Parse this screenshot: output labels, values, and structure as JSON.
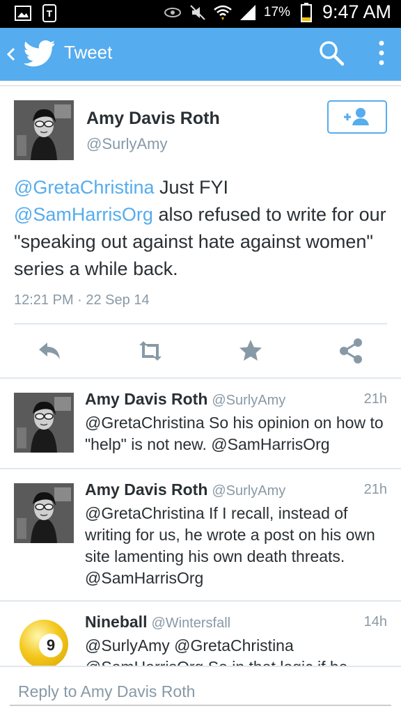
{
  "status_bar": {
    "battery_percent": "17%",
    "time": "9:47 AM",
    "icons": [
      "gallery-icon",
      "tmobile-icon",
      "eye-icon",
      "mute-icon",
      "wifi-icon",
      "signal-icon",
      "battery-icon"
    ]
  },
  "app_bar": {
    "title": "Tweet",
    "color": "#55acee",
    "icons": [
      "back-icon",
      "twitter-bird-icon",
      "search-icon",
      "overflow-menu-icon"
    ]
  },
  "main_tweet": {
    "author_name": "Amy Davis Roth",
    "author_handle": "@SurlyAmy",
    "follow_icon": "add-user-icon",
    "segments": [
      {
        "text": "@GretaChristina",
        "mention": true
      },
      {
        "text": " Just FYI ",
        "mention": false
      },
      {
        "text": "@SamHarrisOrg",
        "mention": true
      },
      {
        "text": " also refused to write for our \"speaking out against hate against women\" series a while back.",
        "mention": false
      }
    ],
    "timestamp": "12:21 PM · 22 Sep 14",
    "actions": [
      "reply-icon",
      "retweet-icon",
      "favorite-icon",
      "share-icon"
    ]
  },
  "replies": [
    {
      "name": "Amy Davis Roth",
      "handle": "@SurlyAmy",
      "time": "21h",
      "text": "@GretaChristina So his opinion on how to \"help\" is not new. @SamHarrisOrg"
    },
    {
      "name": "Amy Davis Roth",
      "handle": "@SurlyAmy",
      "time": "21h",
      "text": "@GretaChristina If I recall, instead of writing for us, he wrote a post on his own site lamenting his own death threats. @SamHarrisOrg"
    },
    {
      "name": "Nineball",
      "handle": "@Wintersfall",
      "time": "14h",
      "text": "@SurlyAmy @GretaChristina @SamHarrisOrg So in that logic if he",
      "avatar_label": "9"
    }
  ],
  "reply_bar": {
    "placeholder": "Reply to Amy Davis Roth"
  }
}
